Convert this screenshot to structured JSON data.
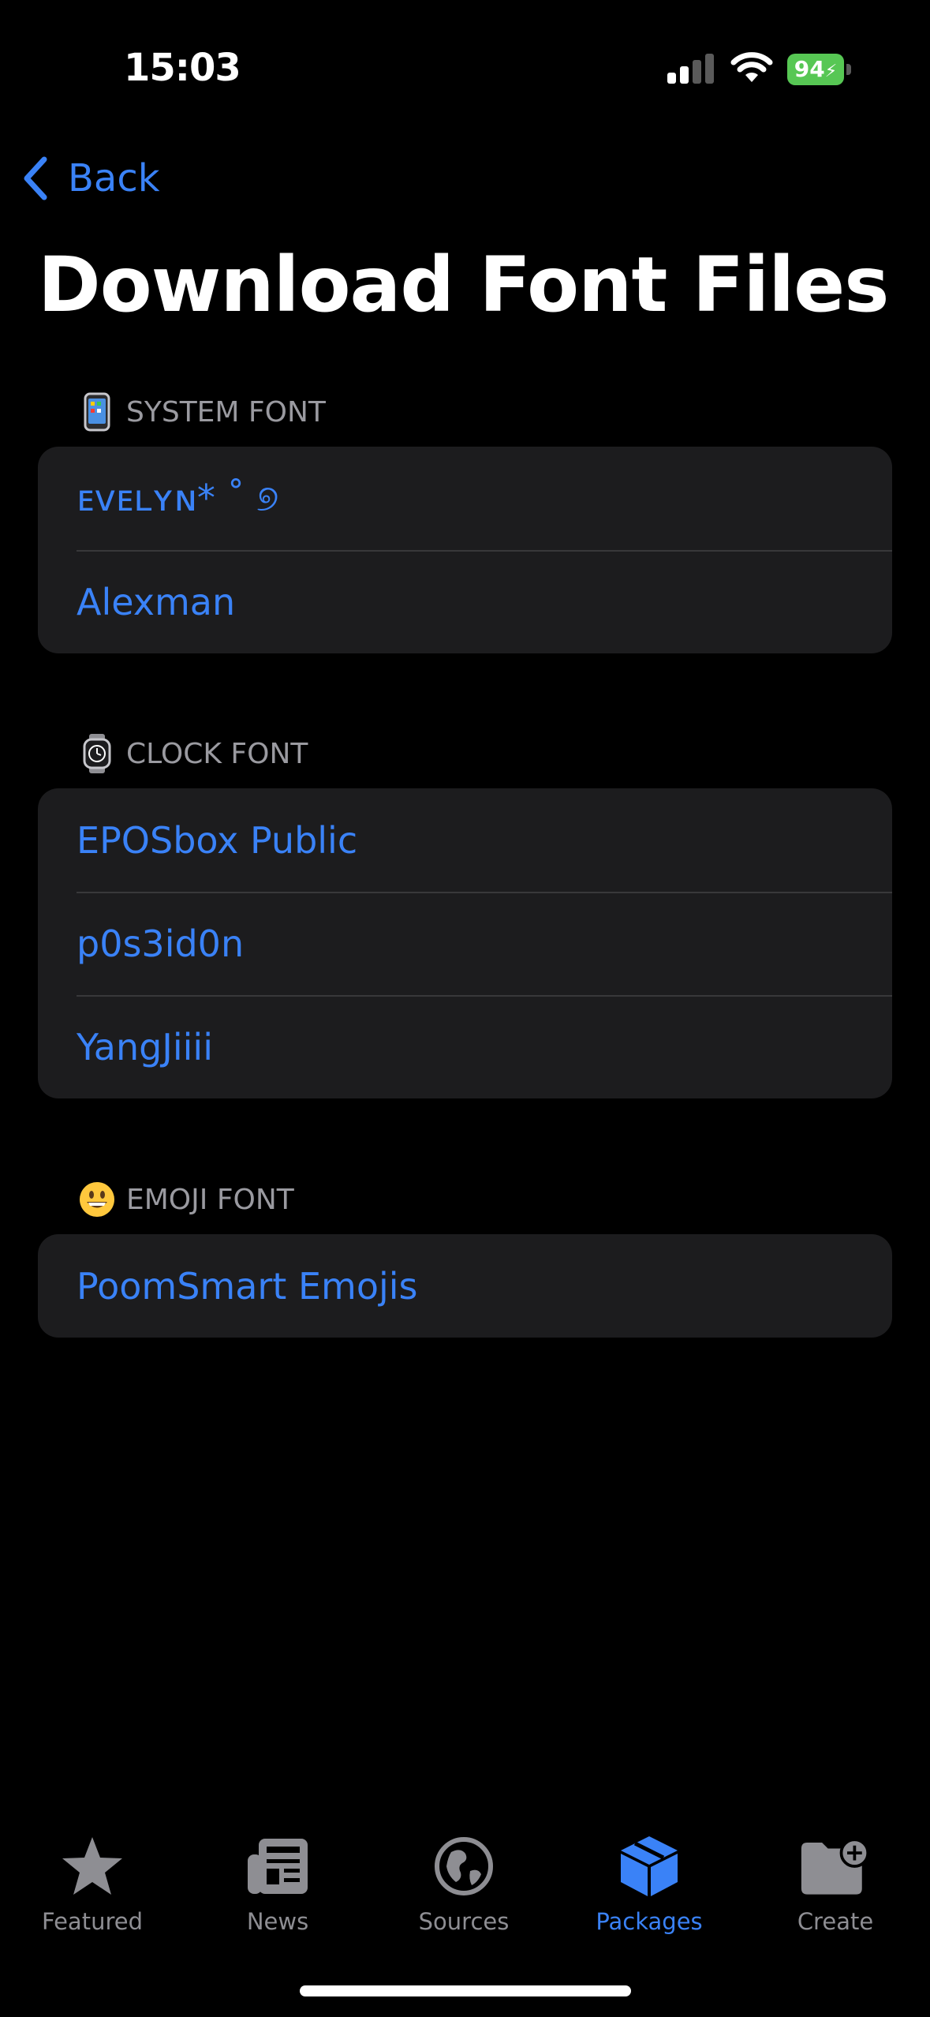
{
  "status_bar": {
    "time": "15:03",
    "battery": "94"
  },
  "nav": {
    "back_label": "Back"
  },
  "page": {
    "title": "Download Font Files"
  },
  "sections": [
    {
      "header": "SYSTEM FONT",
      "icon": "phone-icon",
      "items": [
        "ᴇᴠᴇʟʏɴ* ˚ ୭",
        "Alexman"
      ]
    },
    {
      "header": "CLOCK FONT",
      "icon": "watch-icon",
      "items": [
        "EPOSbox Public",
        "p0s3id0n",
        "YangJiiii"
      ]
    },
    {
      "header": "EMOJI FONT",
      "icon": "grinning-face-icon",
      "items": [
        "PoomSmart Emojis"
      ]
    }
  ],
  "tab_bar": {
    "tabs": [
      {
        "label": "Featured",
        "icon": "star-icon"
      },
      {
        "label": "News",
        "icon": "newspaper-icon"
      },
      {
        "label": "Sources",
        "icon": "globe-icon"
      },
      {
        "label": "Packages",
        "icon": "package-icon",
        "active": true
      },
      {
        "label": "Create",
        "icon": "folder-add-icon"
      }
    ]
  },
  "colors": {
    "accent": "#3a82f7",
    "background": "#000000",
    "group_background": "#1c1c1e",
    "battery": "#57c754"
  }
}
